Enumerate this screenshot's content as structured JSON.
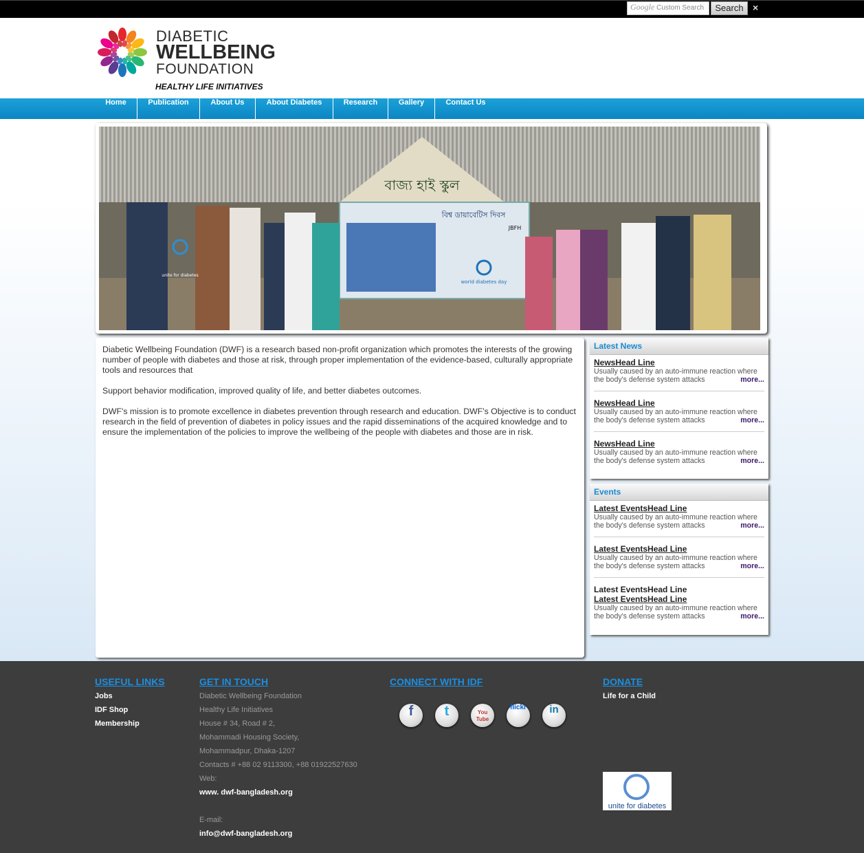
{
  "search": {
    "placeholder": "Custom Search",
    "google_label": "Google",
    "button_label": "Search",
    "close_label": "×"
  },
  "logo": {
    "line1": "DIABETIC",
    "line2": "WELLBEING",
    "line3": "FOUNDATION",
    "tagline": "HEALTHY LIFE INITIATIVES"
  },
  "nav": [
    "Home",
    "Publication",
    "About Us",
    "About Diabetes",
    "Research",
    "Gallery",
    "Contact Us"
  ],
  "banner": {
    "sign_text": "বাজ্য হাই স্কুল",
    "poster_title": "বিশ্ব ডায়াবেটিস দিবস",
    "poster_logo": "JBFH",
    "poster_event": "world diabetes day",
    "shirt_text": "unite for diabetes"
  },
  "main": {
    "paragraphs": [
      "Diabetic Wellbeing Foundation (DWF) is a research based non-profit organization which promotes the interests of the growing number of people with diabetes and those at risk, through proper implementation of the evidence-based, culturally appropriate tools and resources that",
      "Support behavior modification, improved quality of life, and better diabetes outcomes.",
      "DWF's mission is to promote excellence in diabetes prevention through research and education. DWF's Objective is to conduct research in the field of prevention of diabetes in policy issues and the rapid disseminations of the acquired knowledge and to ensure the implementation of the policies to improve the wellbeing of the people with diabetes and those are in risk."
    ]
  },
  "news": {
    "title": "Latest News",
    "items": [
      {
        "headline": "NewsHead Line",
        "text": "Usually caused by an auto-immune reaction where the body's defense system attacks",
        "more": "more..."
      },
      {
        "headline": "NewsHead Line",
        "text": "Usually caused by an auto-immune reaction where the body's defense system attacks",
        "more": "more..."
      },
      {
        "headline": "NewsHead Line",
        "text": "Usually caused by an auto-immune reaction where the body's defense system attacks",
        "more": "more..."
      }
    ]
  },
  "events": {
    "title": "Events",
    "items": [
      {
        "headline": "Latest EventsHead Line",
        "text": "Usually caused by an auto-immune reaction where the body's defense system attacks",
        "more": "more..."
      },
      {
        "headline": "Latest EventsHead Line",
        "text": "Usually caused by an auto-immune reaction where the body's defense system attacks",
        "more": "more..."
      },
      {
        "headline": "Latest EventsHead Line",
        "text": "Usually caused by an auto-immune reaction where the body's defense system attacks",
        "more": "more..."
      }
    ],
    "ghost_headline": "Latest EventsHead Line"
  },
  "footer": {
    "useful": {
      "title": "USEFUL LINKS",
      "links": [
        "Jobs",
        "IDF Shop",
        "Membership"
      ]
    },
    "contact": {
      "title": "GET IN TOUCH",
      "lines": [
        "Diabetic Wellbeing Foundation",
        "Healthy Life Initiatives",
        "House # 34, Road # 2,",
        "Mohammadi Housing Society,",
        "Mohammadpur, Dhaka-1207",
        "Contacts # +88 02 9113300, +88 01922527630"
      ],
      "web_label": "Web:",
      "web": "www. dwf-bangladesh.org",
      "email_label": "E-mail:",
      "email": "info@dwf-bangladesh.org"
    },
    "connect": {
      "title": "CONNECT WITH IDF",
      "icons": [
        {
          "name": "facebook-icon",
          "glyph": "f",
          "color": "#3b5998"
        },
        {
          "name": "twitter-icon",
          "glyph": "t",
          "color": "#29a9e1"
        },
        {
          "name": "youtube-icon",
          "glyph": "You Tube",
          "color": "#c4302b"
        },
        {
          "name": "flickr-icon",
          "glyph": "flickr",
          "color": "#0063dc"
        },
        {
          "name": "linkedin-icon",
          "glyph": "in",
          "color": "#0e76a8"
        }
      ]
    },
    "donate": {
      "title": "DONATE",
      "link": "Life for a Child",
      "badge": "unite for diabetes"
    }
  }
}
